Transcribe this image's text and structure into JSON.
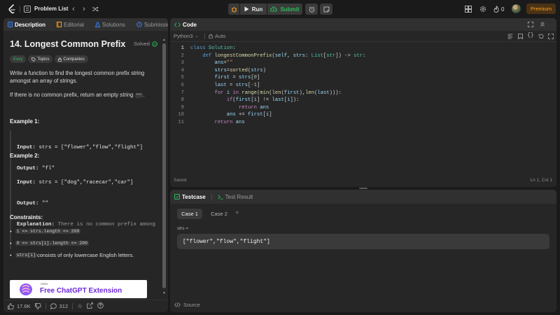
{
  "topbar": {
    "problem_list": "Problem List",
    "run": "Run",
    "submit": "Submit",
    "streak": "0",
    "premium": "Premium"
  },
  "description": {
    "tabs": [
      "Description",
      "Editorial",
      "Solutions",
      "Submissions"
    ],
    "title": "14. Longest Common Prefix",
    "status": "Solved",
    "tags": [
      "Easy",
      "Topics",
      "Companies"
    ],
    "para1": "Write a function to find the longest common prefix string amongst an array of strings.",
    "para2_prefix": "If there is no common prefix, return an empty string",
    "para2_code": "\"\"",
    "para2_suffix": ".",
    "example1_title": "Example 1:",
    "example1_lines": [
      {
        "label": "Input:",
        "value": " strs = [\"flower\",\"flow\",\"flight\"]"
      },
      {
        "label": "Output:",
        "value": " \"fl\""
      }
    ],
    "example2_title": "Example 2:",
    "example2_lines": [
      {
        "label": "Input:",
        "value": " strs = [\"dog\",\"racecar\",\"car\"]"
      },
      {
        "label": "Output:",
        "value": " \"\""
      },
      {
        "label": "Explanation:",
        "value": " There is no common prefix among the input strings."
      }
    ],
    "constraints_title": "Constraints:",
    "constraints": [
      {
        "code": "1 <= strs.length <= 200",
        "text": ""
      },
      {
        "code": "0 <= strs[i].length <= 200",
        "text": ""
      },
      {
        "code": "strs[i]",
        "text": " consists of only lowercase English letters."
      }
    ],
    "ad_small": "Sider",
    "ad_title": "Free ChatGPT Extension",
    "footer": {
      "likes": "17.6K",
      "comments": "312"
    }
  },
  "code": {
    "tab": "Code",
    "language": "Python3",
    "mode": "Auto",
    "status_left": "Saved",
    "status_right": "Ln 1, Col 1"
  },
  "testcase": {
    "tabs": [
      "Testcase",
      "Test Result"
    ],
    "cases": [
      "Case 1",
      "Case 2"
    ],
    "add": "+",
    "param_label": "strs =",
    "param_value": "[\"flower\",\"flow\",\"flight\"]",
    "source": "Source"
  },
  "colors": {
    "accent_green": "#2cbb5d",
    "premium": "#ffa116",
    "background": "#1a1a1a",
    "panel": "#262626"
  }
}
